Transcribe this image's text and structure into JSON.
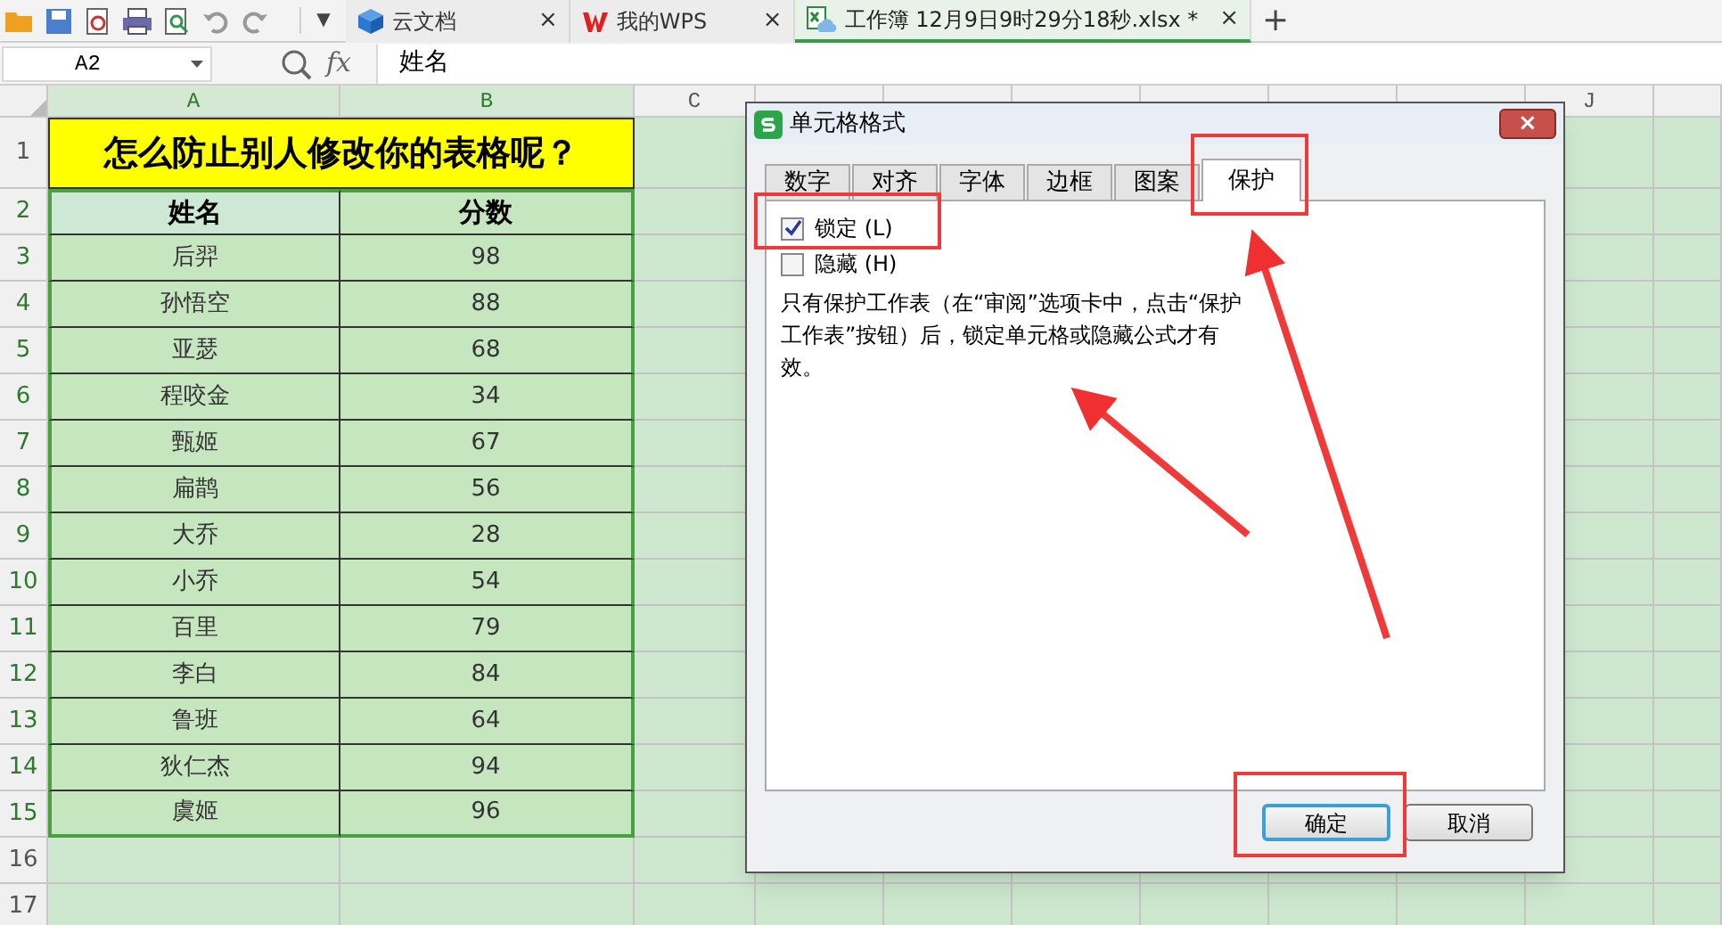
{
  "toolbar": {
    "dropdown": "▼",
    "tabs": [
      {
        "label": "云文档",
        "kind": "cloud",
        "selected": false,
        "close": "×"
      },
      {
        "label": "我的WPS",
        "kind": "wps",
        "selected": false,
        "close": "×"
      },
      {
        "label": "工作簿 12月9日9时29分18秒.xlsx *",
        "kind": "sheet",
        "selected": true,
        "close": "×"
      }
    ],
    "new_tab": "+"
  },
  "formula_bar": {
    "name_box": "A2",
    "formula_label": "fx",
    "value": "姓名"
  },
  "sheet": {
    "columns": [
      "A",
      "B",
      "C",
      "J"
    ],
    "title": "怎么防止别人修改你的表格呢？",
    "headers": [
      "姓名",
      "分数"
    ],
    "rows": [
      [
        "后羿",
        "98"
      ],
      [
        "孙悟空",
        "88"
      ],
      [
        "亚瑟",
        "68"
      ],
      [
        "程咬金",
        "34"
      ],
      [
        "甄姬",
        "67"
      ],
      [
        "扁鹊",
        "56"
      ],
      [
        "大乔",
        "28"
      ],
      [
        "小乔",
        "54"
      ],
      [
        "百里",
        "79"
      ],
      [
        "李白",
        "84"
      ],
      [
        "鲁班",
        "64"
      ],
      [
        "狄仁杰",
        "94"
      ],
      [
        "虞姬",
        "96"
      ]
    ],
    "row_numbers": [
      "1",
      "2",
      "3",
      "4",
      "5",
      "6",
      "7",
      "8",
      "9",
      "10",
      "11",
      "12",
      "13",
      "14",
      "15",
      "16",
      "17"
    ]
  },
  "dialog": {
    "title": "单元格格式",
    "close": "×",
    "tabs": [
      {
        "label": "数字",
        "selected": false
      },
      {
        "label": "对齐",
        "selected": false
      },
      {
        "label": "字体",
        "selected": false
      },
      {
        "label": "边框",
        "selected": false
      },
      {
        "label": "图案",
        "selected": false
      },
      {
        "label": "保护",
        "selected": true
      }
    ],
    "options": [
      {
        "label": "锁定 (L)",
        "checked": true
      },
      {
        "label": "隐藏 (H)",
        "checked": false
      }
    ],
    "note": "只有保护工作表（在“审阅”选项卡中，点击“保护工作表”按钮）后，锁定单元格或隐藏公式才有效。",
    "buttons": [
      {
        "label": "确定",
        "kind": "default"
      },
      {
        "label": "取消",
        "kind": "normal"
      }
    ]
  }
}
